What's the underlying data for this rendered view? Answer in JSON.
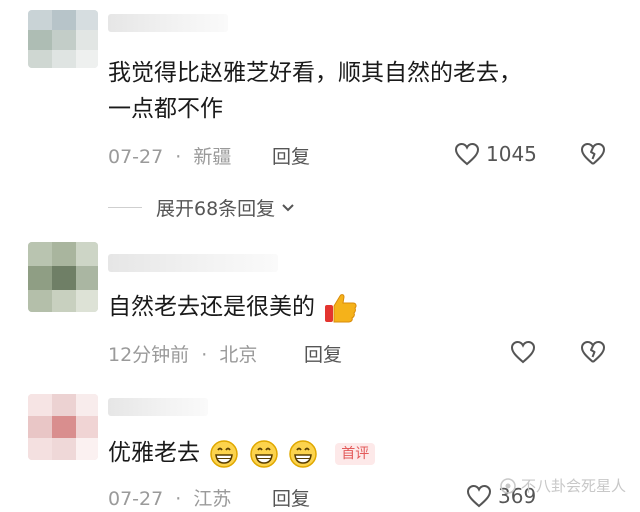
{
  "comments": [
    {
      "text_lines": [
        "我觉得比赵雅芝好看，顺其自然的老去，",
        "一点都不作"
      ],
      "date": "07-27",
      "location": "新疆",
      "reply_label": "回复",
      "likes": "1045",
      "expand_label": "展开68条回复"
    },
    {
      "text": "自然老去还是很美的",
      "date": "12分钟前",
      "location": "北京",
      "reply_label": "回复",
      "likes": ""
    },
    {
      "text": "优雅老去",
      "badge": "首评",
      "date": "07-27",
      "location": "江苏",
      "reply_label": "回复",
      "likes": "369"
    }
  ],
  "meta_separator": "·",
  "watermark": "不八卦会死星人",
  "icons": {
    "like": "heart-outline-icon",
    "dislike": "broken-heart-icon",
    "expand": "chevron-down-icon",
    "thumbs_up": "thumbs-up-emoji",
    "grin": "grinning-face-emoji"
  },
  "colors": {
    "text": "#1a1a1a",
    "meta": "#9a9a9a",
    "badge": "#e35a5a"
  }
}
